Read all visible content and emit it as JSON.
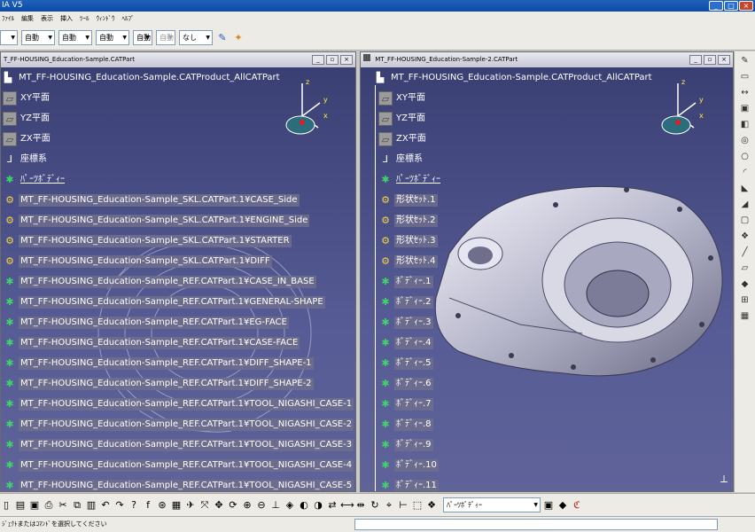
{
  "app": {
    "title": "IA V5"
  },
  "menu": [
    "ﾌｧｲﾙ",
    "編集",
    "表示",
    "挿入",
    "ﾂｰﾙ",
    "ｳｨﾝﾄﾞｳ",
    "ﾍﾙﾌﾟ"
  ],
  "toolbar_top": {
    "selects": [
      "",
      "自動",
      "自動",
      "自動",
      "自動",
      "自動",
      "なし"
    ]
  },
  "left_window": {
    "title": "T_FF-HOUSING_Education-Sample.CATPart",
    "root": "MT_FF-HOUSING_Education-Sample.CATProduct_AllCATPart",
    "nodes": [
      {
        "label": "XY平面",
        "kind": "plane",
        "hl": false
      },
      {
        "label": "YZ平面",
        "kind": "plane",
        "hl": false
      },
      {
        "label": "ZX平面",
        "kind": "plane",
        "hl": false
      },
      {
        "label": "座標系",
        "kind": "axis",
        "hl": false
      },
      {
        "label": "ﾊﾟｰﾂﾎﾞﾃﾞｨｰ",
        "kind": "gear",
        "hl": false,
        "ul": true
      },
      {
        "label": "MT_FF-HOUSING_Education-Sample_SKL.CATPart.1¥CASE_Side",
        "kind": "part",
        "hl": true
      },
      {
        "label": "MT_FF-HOUSING_Education-Sample_SKL.CATPart.1¥ENGINE_Side",
        "kind": "part",
        "hl": true
      },
      {
        "label": "MT_FF-HOUSING_Education-Sample_SKL.CATPart.1¥STARTER",
        "kind": "part",
        "hl": true
      },
      {
        "label": "MT_FF-HOUSING_Education-Sample_SKL.CATPart.1¥DIFF",
        "kind": "part",
        "hl": true
      },
      {
        "label": "MT_FF-HOUSING_Education-Sample_REF.CATPart.1¥CASE_IN_BASE",
        "kind": "gear",
        "hl": true
      },
      {
        "label": "MT_FF-HOUSING_Education-Sample_REF.CATPart.1¥GENERAL-SHAPE",
        "kind": "gear",
        "hl": true
      },
      {
        "label": "MT_FF-HOUSING_Education-Sample_REF.CATPart.1¥EG-FACE",
        "kind": "gear",
        "hl": true
      },
      {
        "label": "MT_FF-HOUSING_Education-Sample_REF.CATPart.1¥CASE-FACE",
        "kind": "gear",
        "hl": true
      },
      {
        "label": "MT_FF-HOUSING_Education-Sample_REF.CATPart.1¥DIFF_SHAPE-1",
        "kind": "gear",
        "hl": true
      },
      {
        "label": "MT_FF-HOUSING_Education-Sample_REF.CATPart.1¥DIFF_SHAPE-2",
        "kind": "gear",
        "hl": true
      },
      {
        "label": "MT_FF-HOUSING_Education-Sample_REF.CATPart.1¥TOOL_NIGASHI_CASE-1",
        "kind": "gear",
        "hl": true
      },
      {
        "label": "MT_FF-HOUSING_Education-Sample_REF.CATPart.1¥TOOL_NIGASHI_CASE-2",
        "kind": "gear",
        "hl": true
      },
      {
        "label": "MT_FF-HOUSING_Education-Sample_REF.CATPart.1¥TOOL_NIGASHI_CASE-3",
        "kind": "gear",
        "hl": true
      },
      {
        "label": "MT_FF-HOUSING_Education-Sample_REF.CATPart.1¥TOOL_NIGASHI_CASE-4",
        "kind": "gear",
        "hl": true
      },
      {
        "label": "MT_FF-HOUSING_Education-Sample_REF.CATPart.1¥TOOL_NIGASHI_CASE-5",
        "kind": "gear",
        "hl": true
      }
    ]
  },
  "right_window": {
    "title": "MT_FF-HOUSING_Education-Sample-2.CATPart",
    "root": "MT_FF-HOUSING_Education-Sample.CATProduct_AllCATPart",
    "nodes": [
      {
        "label": "XY平面",
        "kind": "plane",
        "hl": false
      },
      {
        "label": "YZ平面",
        "kind": "plane",
        "hl": false
      },
      {
        "label": "ZX平面",
        "kind": "plane",
        "hl": false
      },
      {
        "label": "座標系",
        "kind": "axis",
        "hl": false
      },
      {
        "label": "ﾊﾟｰﾂﾎﾞﾃﾞｨｰ",
        "kind": "gear",
        "hl": false,
        "ul": true
      },
      {
        "label": "形状ｾｯﾄ.1",
        "kind": "part",
        "hl": true
      },
      {
        "label": "形状ｾｯﾄ.2",
        "kind": "part",
        "hl": true
      },
      {
        "label": "形状ｾｯﾄ.3",
        "kind": "part",
        "hl": true
      },
      {
        "label": "形状ｾｯﾄ.4",
        "kind": "part",
        "hl": true
      },
      {
        "label": "ﾎﾞﾃﾞｨｰ.1",
        "kind": "gear",
        "hl": true
      },
      {
        "label": "ﾎﾞﾃﾞｨｰ.2",
        "kind": "gear",
        "hl": true
      },
      {
        "label": "ﾎﾞﾃﾞｨｰ.3",
        "kind": "gear",
        "hl": true
      },
      {
        "label": "ﾎﾞﾃﾞｨｰ.4",
        "kind": "gear",
        "hl": true
      },
      {
        "label": "ﾎﾞﾃﾞｨｰ.5",
        "kind": "gear",
        "hl": true
      },
      {
        "label": "ﾎﾞﾃﾞｨｰ.6",
        "kind": "gear",
        "hl": true
      },
      {
        "label": "ﾎﾞﾃﾞｨｰ.7",
        "kind": "gear",
        "hl": true
      },
      {
        "label": "ﾎﾞﾃﾞｨｰ.8",
        "kind": "gear",
        "hl": true
      },
      {
        "label": "ﾎﾞﾃﾞｨｰ.9",
        "kind": "gear",
        "hl": true
      },
      {
        "label": "ﾎﾞﾃﾞｨｰ.10",
        "kind": "gear",
        "hl": true
      },
      {
        "label": "ﾎﾞﾃﾞｨｰ.11",
        "kind": "gear",
        "hl": true
      }
    ]
  },
  "compass": {
    "z": "z",
    "y": "y",
    "x": "x"
  },
  "bottom_toolbar": {
    "select_value": "ﾊﾟｰﾂﾎﾞﾃﾞｨｰ"
  },
  "status": {
    "text": "ｼﾞｪｸﾄまたはｺﾏﾝﾄﾞを選択してください"
  }
}
